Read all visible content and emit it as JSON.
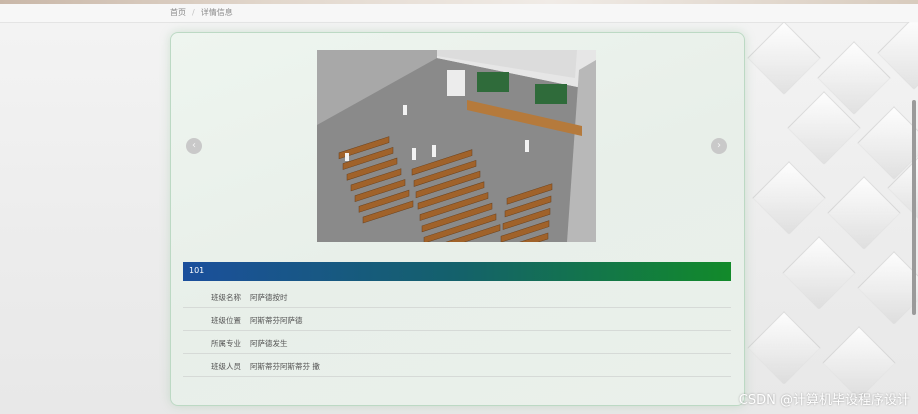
{
  "breadcrumb": {
    "home": "首页",
    "separator": "/",
    "current": "详情信息"
  },
  "carousel": {
    "prev_icon": "chevron-left-icon",
    "next_icon": "chevron-right-icon",
    "prev_glyph": "‹",
    "next_glyph": "›",
    "image": "classroom-photo",
    "slide_count": 1,
    "active_index": 1
  },
  "detail": {
    "title": "101",
    "rows": [
      {
        "label": "班级名称",
        "value": "阿萨德按时"
      },
      {
        "label": "班级位置",
        "value": "阿斯蒂芬阿萨德"
      },
      {
        "label": "所属专业",
        "value": "阿萨德发生"
      },
      {
        "label": "班级人员",
        "value": "阿斯蒂芬阿斯蒂芬 撒"
      }
    ]
  },
  "watermark": "CSDN @计算机毕设程序设计",
  "colors": {
    "title_bar_start": "#1b4f9c",
    "title_bar_end": "#128a2a",
    "card_border": "#bcd9c4"
  }
}
